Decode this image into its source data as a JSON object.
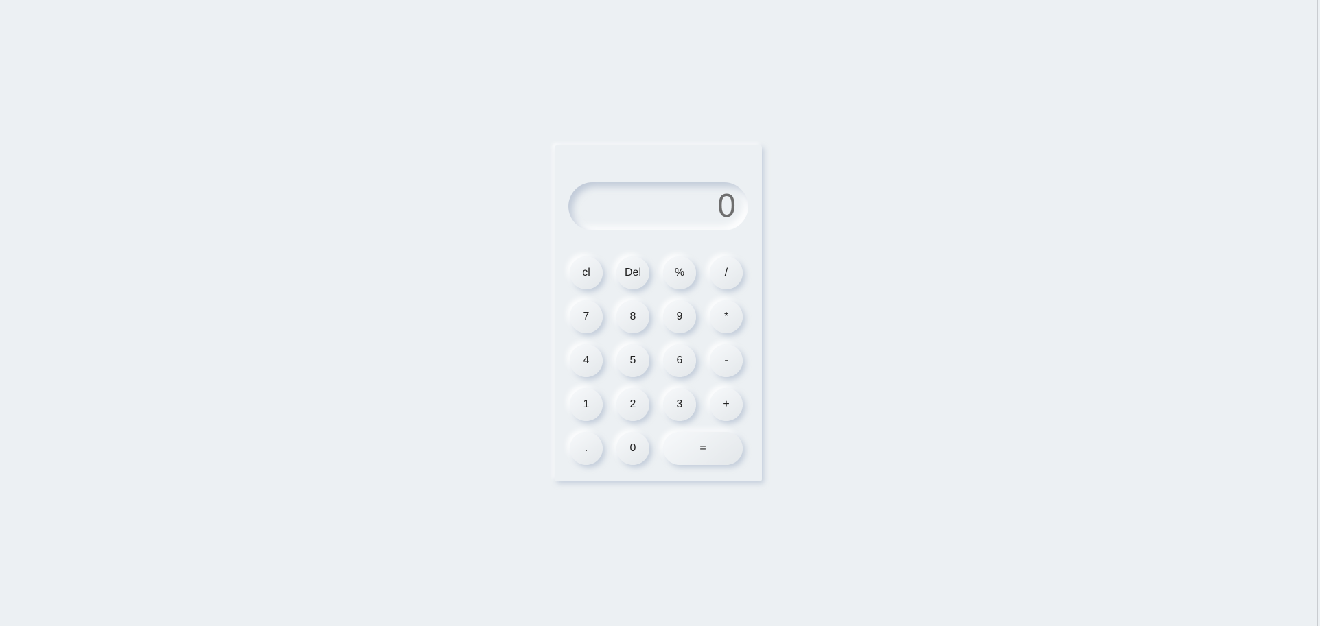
{
  "display": {
    "value": "0"
  },
  "keys": {
    "clear": "cl",
    "delete": "Del",
    "percent": "%",
    "divide": "/",
    "seven": "7",
    "eight": "8",
    "nine": "9",
    "multiply": "*",
    "four": "4",
    "five": "5",
    "six": "6",
    "subtract": "-",
    "one": "1",
    "two": "2",
    "three": "3",
    "add": "+",
    "decimal": ".",
    "zero": "0",
    "equals": "="
  },
  "colors": {
    "background": "#ecf0f3",
    "display_text": "#6e6e6e",
    "key_text": "#222222"
  }
}
